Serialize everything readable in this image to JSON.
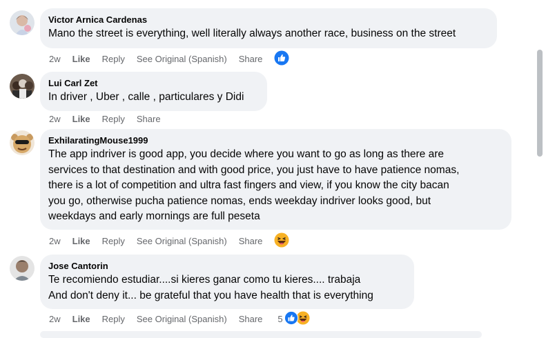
{
  "comments": [
    {
      "author": "Victor Arnica Cardenas",
      "text": "Mano the street is everything, well literally always another race, business on the street",
      "time": "2w",
      "like": "Like",
      "reply": "Reply",
      "see_original": "See Original (Spanish)",
      "share": "Share",
      "reaction_icons": [
        "like-reaction-icon"
      ]
    },
    {
      "author": "Lui Carl Zet",
      "text": "In driver , Uber , calle , particulares y Didi",
      "time": "2w",
      "like": "Like",
      "reply": "Reply",
      "share": "Share"
    },
    {
      "author": "ExhilaratingMouse1999",
      "text": "The app indriver is good app, you decide where you want to go as long as there are\nservices to that destination and with good price, you just have to have patience nomas,\nthere is a lot of competition and ultra fast fingers and view, if you know the city bacan\nyou go, otherwise pucha patience nomas, ends weekday indriver looks good, but\nweekdays and early mornings are full peseta",
      "time": "2w",
      "like": "Like",
      "reply": "Reply",
      "see_original": "See Original (Spanish)",
      "share": "Share",
      "reaction_icons": [
        "haha-reaction-icon"
      ]
    },
    {
      "author": "Jose Cantorin",
      "text": "Te recomiendo estudiar....si kieres ganar como tu kieres.... trabaja\nAnd don't deny it... be grateful that you have health that is everything",
      "time": "2w",
      "like": "Like",
      "reply": "Reply",
      "see_original": "See Original (Spanish)",
      "share": "Share",
      "reaction_count": "5",
      "reaction_icons": [
        "like-reaction-icon",
        "haha-reaction-icon"
      ]
    }
  ],
  "colors": {
    "bubble": "#f0f2f5",
    "meta_text": "#65676b",
    "like_blue": "#1877f2",
    "haha_yellow": "#f7b125"
  }
}
